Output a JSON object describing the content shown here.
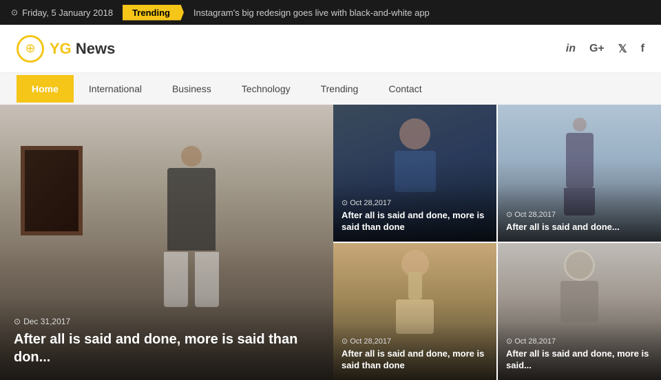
{
  "topbar": {
    "date": "Friday, 5 January 2018",
    "trending_label": "Trending",
    "headline": "Instagram's big redesign goes live with black-and-white app"
  },
  "header": {
    "logo_text": "YG",
    "logo_name": "News",
    "social": [
      "in",
      "G+",
      "🐦",
      "f"
    ]
  },
  "nav": {
    "items": [
      {
        "label": "Home",
        "active": true
      },
      {
        "label": "International",
        "active": false
      },
      {
        "label": "Business",
        "active": false
      },
      {
        "label": "Technology",
        "active": false
      },
      {
        "label": "Trending",
        "active": false
      },
      {
        "label": "Contact",
        "active": false
      }
    ]
  },
  "featured": {
    "date": "Dec 31,2017",
    "title": "After all is said and done, more is said than don..."
  },
  "grid_items": [
    {
      "date": "Oct 28,2017",
      "title": "After all is said and done, more is said than done"
    },
    {
      "date": "Oct 28,2017",
      "title": "After all is said and done..."
    },
    {
      "date": "Oct 28,2017",
      "title": "After all is said and done, more is said than done"
    },
    {
      "date": "Oct 28,2017",
      "title": "After all is said and done, more is said..."
    }
  ],
  "icons": {
    "clock": "⊙",
    "globe": "🌐",
    "linkedin": "in",
    "googleplus": "G+",
    "twitter": "𝕏",
    "facebook": "f"
  },
  "colors": {
    "accent": "#f5c518",
    "dark": "#1a1a1a",
    "text_light": "#ffffff",
    "nav_bg": "#f5f5f5"
  }
}
